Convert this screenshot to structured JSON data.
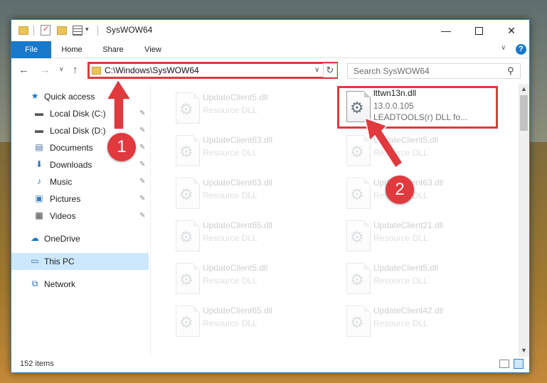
{
  "window": {
    "title": "SysWOW64",
    "minimize_glyph": "—",
    "close_glyph": "✕"
  },
  "ribbon": {
    "tabs": [
      "File",
      "Home",
      "Share",
      "View"
    ],
    "expand_glyph": "∨",
    "help_glyph": "?"
  },
  "navbar": {
    "back_glyph": "←",
    "forward_glyph": "→",
    "recent_glyph": "∨",
    "up_glyph": "↑",
    "address": "C:\\Windows\\SysWOW64",
    "address_dropdown_glyph": "∨",
    "refresh_glyph": "↻",
    "search_placeholder": "Search SysWOW64",
    "search_glyph": "⚲"
  },
  "sidebar": {
    "items": [
      {
        "label": "Quick access",
        "icon": "star-icon",
        "glyph": "★",
        "color": "#1979ca",
        "pinned": false
      },
      {
        "label": "Local Disk (C:)",
        "icon": "drive-icon",
        "glyph": "▬",
        "color": "#555555",
        "pinned": true
      },
      {
        "label": "Local Disk (D:)",
        "icon": "drive-icon",
        "glyph": "▬",
        "color": "#555555",
        "pinned": true
      },
      {
        "label": "Documents",
        "icon": "documents-icon",
        "glyph": "▤",
        "color": "#4a6fa5",
        "pinned": true
      },
      {
        "label": "Downloads",
        "icon": "download-icon",
        "glyph": "⬇",
        "color": "#1979ca",
        "pinned": true
      },
      {
        "label": "Music",
        "icon": "music-icon",
        "glyph": "♪",
        "color": "#1979ca",
        "pinned": true
      },
      {
        "label": "Pictures",
        "icon": "pictures-icon",
        "glyph": "▣",
        "color": "#3a7fbf",
        "pinned": true
      },
      {
        "label": "Videos",
        "icon": "videos-icon",
        "glyph": "▦",
        "color": "#444444",
        "pinned": true
      },
      {
        "label": "OneDrive",
        "icon": "cloud-icon",
        "glyph": "☁",
        "color": "#1979ca",
        "pinned": false
      },
      {
        "label": "This PC",
        "icon": "computer-icon",
        "glyph": "▭",
        "color": "#2b6ea8",
        "pinned": false
      },
      {
        "label": "Network",
        "icon": "network-icon",
        "glyph": "⧉",
        "color": "#2b6ea8",
        "pinned": false
      }
    ],
    "pin_glyph": "✎"
  },
  "files": {
    "highlighted": {
      "name": "lttwn13n.dll",
      "version": "13.0.0.105",
      "description": "LEADTOOLS(r) DLL fo..."
    },
    "left_column": [
      {
        "name": "UpdateClient5.dll",
        "type": "Resource DLL"
      },
      {
        "name": "UpdateClient63.dll",
        "type": "Resource DLL"
      },
      {
        "name": "UpdateClient63.dll",
        "type": "Resource DLL"
      },
      {
        "name": "UpdateClient65.dll",
        "type": "Resource DLL"
      },
      {
        "name": "UpdateClient5.dll",
        "type": "Resource DLL"
      },
      {
        "name": "UpdateClient65.dll",
        "type": "Resource DLL"
      }
    ],
    "right_column": [
      {
        "name": "UpdateClient5.dll",
        "type": "Resource DLL"
      },
      {
        "name": "UpdateClient63.dll",
        "type": "Resource DLL"
      },
      {
        "name": "UpdateClient21.dll",
        "type": "Resource DLL"
      },
      {
        "name": "UpdateClient5.dll",
        "type": "Resource DLL"
      },
      {
        "name": "UpdateClient42.dll",
        "type": "Resource DLL"
      }
    ]
  },
  "status": {
    "item_count": "152 items"
  },
  "annotations": {
    "step1": "1",
    "step2": "2",
    "color": "#e0393e"
  }
}
